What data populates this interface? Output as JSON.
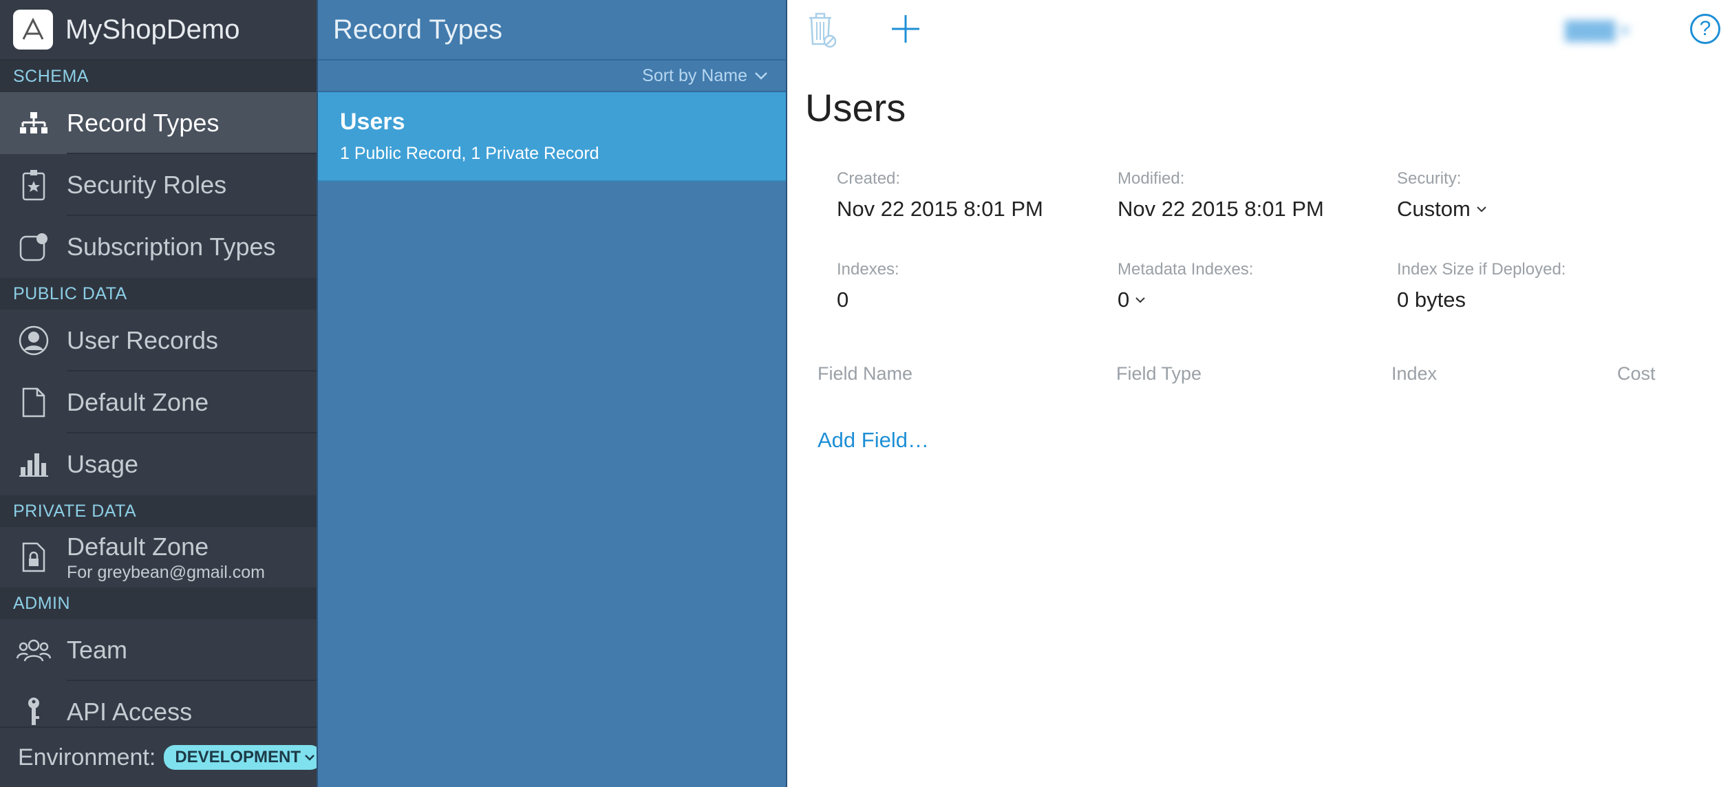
{
  "app": {
    "title": "MyShopDemo"
  },
  "sidebar": {
    "sections": [
      {
        "label": "SCHEMA"
      },
      {
        "label": "PUBLIC DATA"
      },
      {
        "label": "PRIVATE DATA"
      },
      {
        "label": "ADMIN"
      }
    ],
    "items": [
      {
        "label": "Record Types",
        "icon": "hierarchy-icon",
        "active": true
      },
      {
        "label": "Security Roles",
        "icon": "badge-star-icon"
      },
      {
        "label": "Subscription Types",
        "icon": "notification-icon"
      },
      {
        "label": "User Records",
        "icon": "user-circle-icon"
      },
      {
        "label": "Default Zone",
        "icon": "document-icon"
      },
      {
        "label": "Usage",
        "icon": "bar-chart-icon"
      },
      {
        "label": "Default Zone",
        "sublabel": "For greybean@gmail.com",
        "icon": "lock-document-icon"
      },
      {
        "label": "Team",
        "icon": "team-icon"
      },
      {
        "label": "API Access",
        "icon": "key-icon"
      }
    ],
    "environment": {
      "label": "Environment:",
      "value": "DEVELOPMENT"
    }
  },
  "types": {
    "header": "Record Types",
    "sort_label": "Sort by Name",
    "rows": [
      {
        "name": "Users",
        "counts": "1 Public Record, 1 Private Record"
      }
    ]
  },
  "detail": {
    "title": "Users",
    "created_label": "Created:",
    "created_value": "Nov 22 2015 8:01 PM",
    "modified_label": "Modified:",
    "modified_value": "Nov 22 2015 8:01 PM",
    "security_label": "Security:",
    "security_value": "Custom",
    "indexes_label": "Indexes:",
    "indexes_value": "0",
    "metadata_label": "Metadata Indexes:",
    "metadata_value": "0",
    "index_size_label": "Index Size if Deployed:",
    "index_size_value": "0 bytes",
    "columns": [
      "Field Name",
      "Field Type",
      "Index",
      "Cost"
    ],
    "add_field": "Add Field…",
    "help": "?"
  },
  "colors": {
    "sidebar_bg": "#353c47",
    "section_text": "#8ccfe6",
    "types_bg": "#427bac",
    "selected_row": "#3fa0d6",
    "accent": "#1e8fd6",
    "env_badge": "#7fe0ee"
  }
}
